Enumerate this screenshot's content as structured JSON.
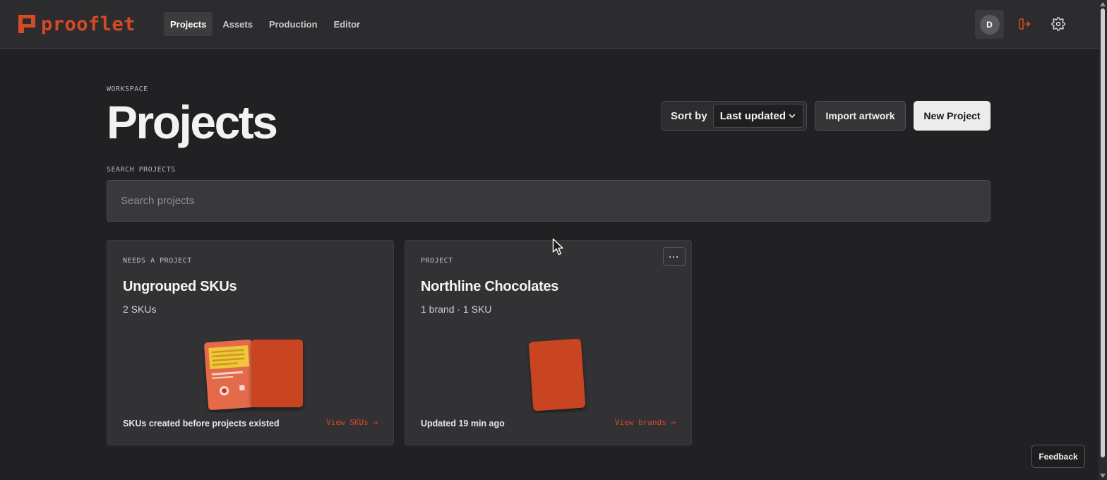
{
  "app": {
    "name": "prooflet"
  },
  "nav": {
    "items": [
      {
        "label": "Projects",
        "active": true
      },
      {
        "label": "Assets",
        "active": false
      },
      {
        "label": "Production",
        "active": false
      },
      {
        "label": "Editor",
        "active": false
      }
    ]
  },
  "user": {
    "avatar_initial": "D"
  },
  "header": {
    "eyebrow": "WORKSPACE",
    "title": "Projects",
    "sort_label": "Sort by",
    "sort_value": "Last updated",
    "import_label": "Import artwork",
    "new_label": "New Project"
  },
  "search": {
    "label": "SEARCH PROJECTS",
    "placeholder": "Search projects",
    "value": ""
  },
  "cards": [
    {
      "eyebrow": "NEEDS A PROJECT",
      "title": "Ungrouped SKUs",
      "subtitle": "2 SKUs",
      "footer": "SKUs created before projects existed",
      "link": "View SKUs →"
    },
    {
      "eyebrow": "PROJECT",
      "title": "Northline Chocolates",
      "subtitle": "1 brand · 1 SKU",
      "footer": "Updated 19 min ago",
      "link": "View brands →",
      "menu_label": "···"
    }
  ],
  "feedback": {
    "label": "Feedback"
  },
  "colors": {
    "accent": "#d34a24",
    "background": "#212123",
    "surface": "#323235",
    "packaging_yellow": "#f2c53d"
  }
}
